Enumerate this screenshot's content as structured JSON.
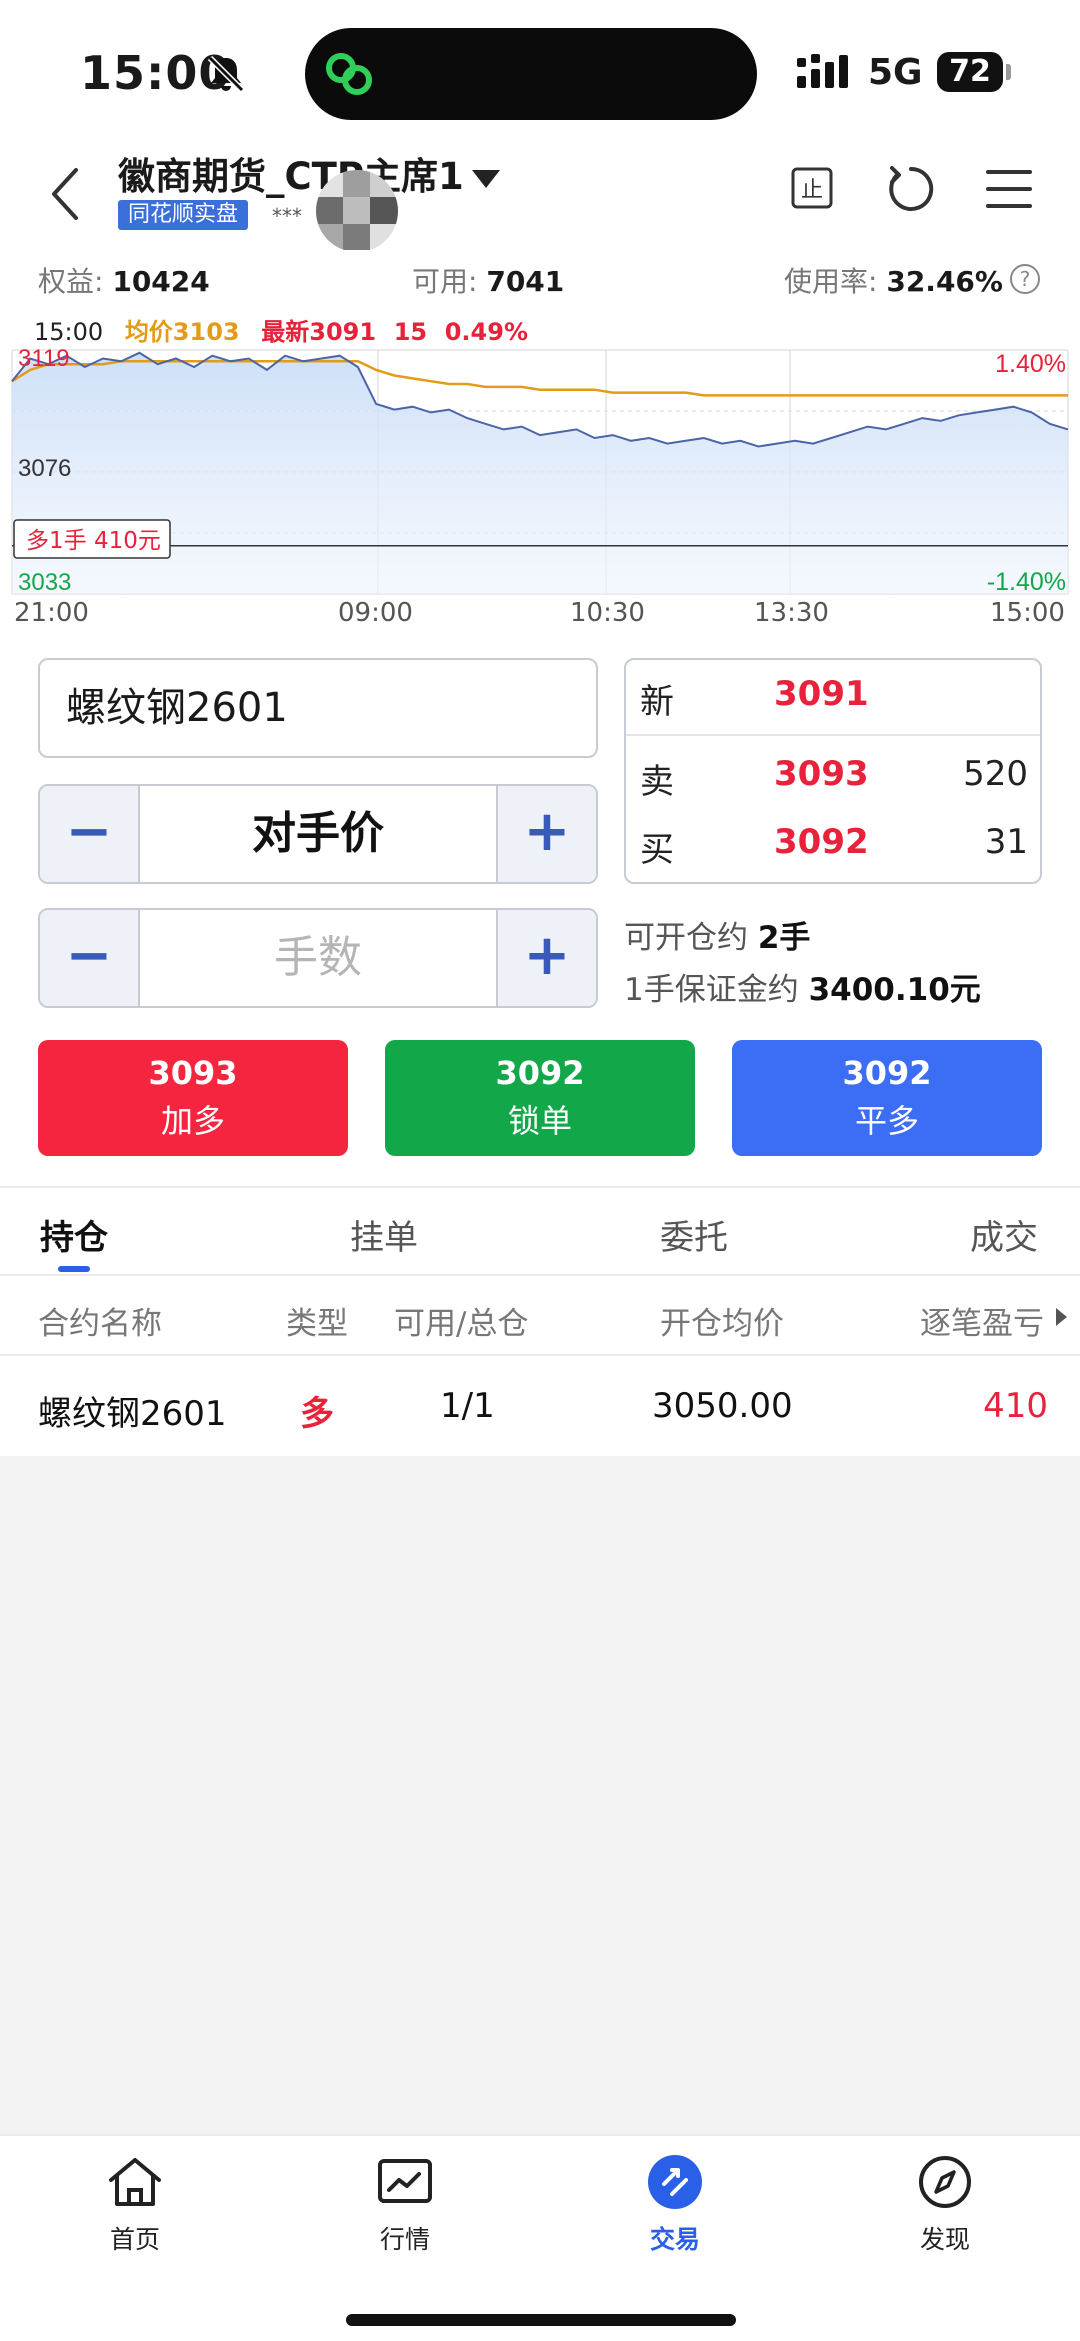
{
  "status_bar": {
    "time": "15:00",
    "network": "5G",
    "battery": "72"
  },
  "header": {
    "account_name": "徽商期货_CTP主席1",
    "account_badge": "同花顺实盘",
    "account_masked": "***"
  },
  "stats": {
    "equity_label": "权益:",
    "equity_value": "10424",
    "available_label": "可用:",
    "available_value": "7041",
    "usage_label": "使用率:",
    "usage_value": "32.46%",
    "help_icon": "?"
  },
  "chart": {
    "legend_time": "15:00",
    "legend_avg": "均价3103",
    "legend_last": "最新3091",
    "legend_change": "15",
    "legend_pct": "0.49%",
    "price_high": "3119",
    "price_mid": "3076",
    "price_low": "3033",
    "pct_high": "1.40%",
    "pct_low": "-1.40%",
    "position_tag": "多1手 410元",
    "x_labels": [
      "21:00",
      "09:00",
      "10:30",
      "13:30",
      "15:00"
    ]
  },
  "chart_data": {
    "type": "line",
    "ylim": [
      3033,
      3119
    ],
    "reference_price": 3076,
    "position_price": 3050,
    "series": [
      {
        "name": "最新",
        "values": [
          3108,
          3116,
          3114,
          3117,
          3113,
          3116,
          3115,
          3118,
          3114,
          3116,
          3113,
          3117,
          3115,
          3116,
          3112,
          3117,
          3115,
          3116,
          3117,
          3113,
          3100,
          3098,
          3099,
          3097,
          3098,
          3095,
          3093,
          3091,
          3092,
          3089,
          3090,
          3091,
          3088,
          3089,
          3087,
          3088,
          3086,
          3087,
          3088,
          3086,
          3087,
          3085,
          3086,
          3087,
          3086,
          3088,
          3090,
          3092,
          3091,
          3093,
          3095,
          3094,
          3096,
          3097,
          3098,
          3099,
          3097,
          3093,
          3091
        ]
      },
      {
        "name": "均价",
        "values": [
          3108,
          3112,
          3114,
          3114,
          3114,
          3114,
          3115,
          3115,
          3115,
          3115,
          3115,
          3115,
          3115,
          3115,
          3115,
          3115,
          3115,
          3115,
          3115,
          3115,
          3112,
          3110,
          3109,
          3108,
          3107,
          3107,
          3106,
          3106,
          3106,
          3105,
          3105,
          3105,
          3105,
          3104,
          3104,
          3104,
          3104,
          3104,
          3103,
          3103,
          3103,
          3103,
          3103,
          3103,
          3103,
          3103,
          3103,
          3103,
          3103,
          3103,
          3103,
          3103,
          3103,
          3103,
          3103,
          3103,
          3103,
          3103,
          3103
        ]
      }
    ]
  },
  "order": {
    "contract": "螺纹钢2601",
    "price_mode": "对手价",
    "qty_placeholder": "手数",
    "minus": "−",
    "plus": "+",
    "quote": {
      "new_label": "新",
      "new_price": "3091",
      "sell_label": "卖",
      "sell_price": "3093",
      "sell_vol": "520",
      "buy_label": "买",
      "buy_price": "3092",
      "buy_vol": "31"
    },
    "openable_label": "可开仓约",
    "openable_value": "2手",
    "margin_label": "1手保证金约",
    "margin_value": "3400.10元",
    "buttons": [
      {
        "price": "3093",
        "label": "加多",
        "color": "#f5253f"
      },
      {
        "price": "3092",
        "label": "锁单",
        "color": "#12a84a"
      },
      {
        "price": "3092",
        "label": "平多",
        "color": "#3b6ef5"
      }
    ]
  },
  "tabs": [
    "持仓",
    "挂单",
    "委托",
    "成交"
  ],
  "positions": {
    "headers": [
      "合约名称",
      "类型",
      "可用/总仓",
      "开仓均价",
      "逐笔盈亏"
    ],
    "rows": [
      {
        "name": "螺纹钢2601",
        "type": "多",
        "avail": "1/1",
        "avg_price": "3050.00",
        "pnl": "410"
      }
    ]
  },
  "bottom_nav": [
    {
      "label": "首页",
      "icon": "home-icon"
    },
    {
      "label": "行情",
      "icon": "chart-icon"
    },
    {
      "label": "交易",
      "icon": "trade-icon"
    },
    {
      "label": "发现",
      "icon": "compass-icon"
    }
  ]
}
